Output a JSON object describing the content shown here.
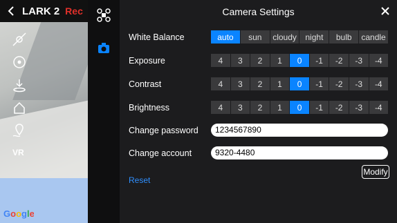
{
  "header": {
    "title": "LARK 2",
    "red_label": "Rec"
  },
  "map": {
    "logo_text": "Google"
  },
  "panel": {
    "title": "Camera Settings",
    "white_balance": {
      "label": "White Balance",
      "options": [
        "auto",
        "sun",
        "cloudy",
        "night",
        "bulb",
        "candle"
      ],
      "selected": "auto"
    },
    "exposure": {
      "label": "Exposure",
      "options": [
        "4",
        "3",
        "2",
        "1",
        "0",
        "-1",
        "-2",
        "-3",
        "-4"
      ],
      "selected": "0"
    },
    "contrast": {
      "label": "Contrast",
      "options": [
        "4",
        "3",
        "2",
        "1",
        "0",
        "-1",
        "-2",
        "-3",
        "-4"
      ],
      "selected": "0"
    },
    "brightness": {
      "label": "Brightness",
      "options": [
        "4",
        "3",
        "2",
        "1",
        "0",
        "-1",
        "-2",
        "-3",
        "-4"
      ],
      "selected": "0"
    },
    "change_password": {
      "label": "Change password",
      "value": "1234567890"
    },
    "change_account": {
      "label": "Change account",
      "value": "9320-4480"
    },
    "modify_label": "Modify",
    "reset_label": "Reset"
  },
  "colors": {
    "accent": "#0a84ff",
    "red": "#e0302a",
    "panel_bg": "#1c1c1e"
  },
  "icons": [
    "back-arrow-icon",
    "drone-icon",
    "camera-icon",
    "close-icon",
    "gimbal-icon",
    "takeoff-icon",
    "landing-icon",
    "waypoint-icon",
    "vr-icon"
  ]
}
